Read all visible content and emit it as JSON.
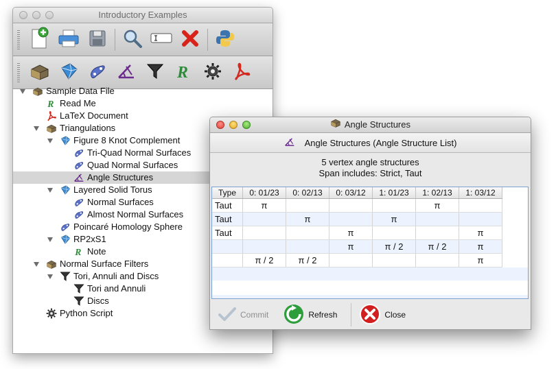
{
  "main_window": {
    "title": "Introductory Examples",
    "toolbar_row1": [
      {
        "icon": "new-document-icon"
      },
      {
        "icon": "print-icon"
      },
      {
        "icon": "save-icon"
      },
      {
        "icon": "magnifier-icon"
      },
      {
        "icon": "rename-field-icon"
      },
      {
        "icon": "delete-icon"
      },
      {
        "icon": "python-icon"
      }
    ],
    "toolbar_row2": [
      {
        "icon": "container-icon"
      },
      {
        "icon": "triangulation-icon"
      },
      {
        "icon": "normal-surfaces-icon"
      },
      {
        "icon": "angle-structures-icon"
      },
      {
        "icon": "filter-icon"
      },
      {
        "icon": "text-r-icon"
      },
      {
        "icon": "script-gear-icon"
      },
      {
        "icon": "pdf-icon"
      }
    ],
    "tree": [
      {
        "label": "Sample Data File",
        "icon": "container-icon",
        "level": 0,
        "expanded": true
      },
      {
        "label": "Read Me",
        "icon": "text-r-icon",
        "level": 1
      },
      {
        "label": "LaTeX Document",
        "icon": "pdf-icon",
        "level": 1
      },
      {
        "label": "Triangulations",
        "icon": "container-icon",
        "level": 1,
        "expanded": true
      },
      {
        "label": "Figure 8 Knot Complement",
        "icon": "triangulation-icon",
        "level": 2,
        "expanded": true
      },
      {
        "label": "Tri-Quad Normal Surfaces",
        "icon": "normal-surfaces-icon",
        "level": 3
      },
      {
        "label": "Quad Normal Surfaces",
        "icon": "normal-surfaces-icon",
        "level": 3
      },
      {
        "label": "Angle Structures",
        "icon": "angle-structures-icon",
        "level": 3,
        "selected": true
      },
      {
        "label": "Layered Solid Torus",
        "icon": "triangulation-icon",
        "level": 2,
        "expanded": true
      },
      {
        "label": "Normal Surfaces",
        "icon": "normal-surfaces-icon",
        "level": 3
      },
      {
        "label": "Almost Normal Surfaces",
        "icon": "normal-surfaces-icon",
        "level": 3
      },
      {
        "label": "Poincaré Homology Sphere",
        "icon": "normal-surfaces-icon",
        "level": 2
      },
      {
        "label": "RP2xS1",
        "icon": "triangulation-icon",
        "level": 2,
        "expanded": true
      },
      {
        "label": "Note",
        "icon": "text-r-icon",
        "level": 3
      },
      {
        "label": "Normal Surface Filters",
        "icon": "container-icon",
        "level": 1,
        "expanded": true
      },
      {
        "label": "Tori, Annuli and Discs",
        "icon": "filter-icon",
        "level": 2,
        "expanded": true
      },
      {
        "label": "Tori and Annuli",
        "icon": "filter-icon",
        "level": 3
      },
      {
        "label": "Discs",
        "icon": "filter-icon",
        "level": 3
      },
      {
        "label": "Python Script",
        "icon": "script-gear-icon",
        "level": 1
      }
    ]
  },
  "dialog": {
    "title": "Angle Structures",
    "header": "Angle Structures (Angle Structure List)",
    "summary_line1": "5 vertex angle structures",
    "summary_line2": "Span includes: Strict, Taut",
    "columns": [
      "Type",
      "0: 01/23",
      "0: 02/13",
      "0: 03/12",
      "1: 01/23",
      "1: 02/13",
      "1: 03/12"
    ],
    "rows": [
      [
        "Taut",
        "π",
        "",
        "",
        "",
        "π",
        ""
      ],
      [
        "Taut",
        "",
        "π",
        "",
        "π",
        "",
        ""
      ],
      [
        "Taut",
        "",
        "",
        "π",
        "",
        "",
        "π"
      ],
      [
        "",
        "",
        "",
        "π",
        "π / 2",
        "π / 2",
        "π"
      ],
      [
        "",
        "π / 2",
        "π / 2",
        "",
        "",
        "",
        "π"
      ]
    ],
    "buttons": {
      "commit": "Commit",
      "refresh": "Refresh",
      "close": "Close"
    },
    "colors": {
      "selection_alt_row": "#edf3fe",
      "table_border": "#7da0d2"
    }
  }
}
